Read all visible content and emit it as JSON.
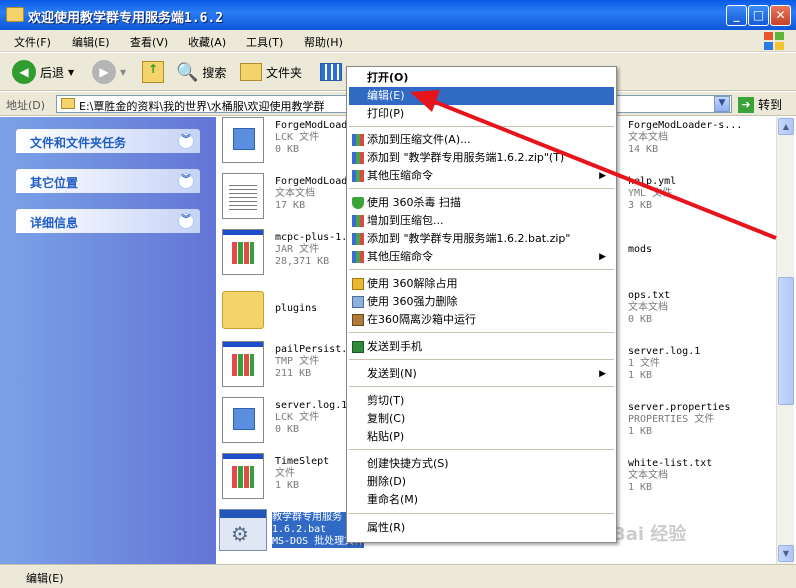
{
  "window": {
    "title": "欢迎使用教学群专用服务端1.6.2",
    "buttons": [
      "_",
      "□",
      "✕"
    ]
  },
  "menubar": [
    "文件(F)",
    "编辑(E)",
    "查看(V)",
    "收藏(A)",
    "工具(T)",
    "帮助(H)"
  ],
  "toolbar": {
    "back": "后退",
    "search": "搜索",
    "folders": "文件夹"
  },
  "address": {
    "label": "地址(D)",
    "path": "E:\\覃胜金的资料\\我的世界\\水桶服\\欢迎使用教学群",
    "go": "转到"
  },
  "left_panels": [
    "文件和文件夹任务",
    "其它位置",
    "详细信息"
  ],
  "files_left": [
    {
      "name": "ForgeModLoade",
      "type": "LCK 文件",
      "size": "0 KB",
      "icon": "blue-doc-icon"
    },
    {
      "name": "ForgeModLoad",
      "type": "文本文档",
      "size": "17 KB",
      "icon": "text-doc-icon"
    },
    {
      "name": "mcpc-plus-1.6",
      "type": "JAR 文件",
      "size": "28,371 KB",
      "icon": "app-doc-icon"
    },
    {
      "name": "plugins",
      "type": "",
      "size": "",
      "icon": "folder-icon"
    },
    {
      "name": "pailPersist.",
      "type": "TMP 文件",
      "size": "211 KB",
      "icon": "app-doc-icon"
    },
    {
      "name": "server.log.1.",
      "type": "LCK 文件",
      "size": "0 KB",
      "icon": "blue-doc-icon"
    },
    {
      "name": "TimeSlept",
      "type": "文件",
      "size": "1 KB",
      "icon": "app-doc-icon"
    }
  ],
  "selected_file": {
    "name": "教学群专用服务",
    "line2": "1.6.2.bat",
    "type": "MS-DOS 批处理文件"
  },
  "files_right": [
    {
      "name": "ForgeModLoader-s...",
      "type": "文本文档",
      "size": "14 KB"
    },
    {
      "name": "help.yml",
      "type": "YML 文件",
      "size": "3 KB"
    },
    {
      "name": "mods",
      "type": "",
      "size": ""
    },
    {
      "name": "ops.txt",
      "type": "文本文档",
      "size": "0 KB"
    },
    {
      "name": "server.log.1",
      "type": "1 文件",
      "size": "1 KB"
    },
    {
      "name": "server.properties",
      "type": "PROPERTIES 文件",
      "size": "1 KB"
    },
    {
      "name": "white-list.txt",
      "type": "文本文档",
      "size": "1 KB"
    }
  ],
  "context_menu": [
    {
      "label": "打开(O)",
      "bold": true
    },
    {
      "label": "编辑(E)",
      "highlight": true
    },
    {
      "label": "打印(P)"
    },
    {
      "sep": true
    },
    {
      "label": "添加到压缩文件(A)...",
      "icon": "winrar-icon"
    },
    {
      "label": "添加到 \"教学群专用服务端1.6.2.zip\"(T)",
      "icon": "winrar-icon"
    },
    {
      "label": "其他压缩命令",
      "icon": "winrar-icon",
      "submenu": true
    },
    {
      "sep": true
    },
    {
      "label": "使用 360杀毒 扫描",
      "icon": "shield-icon"
    },
    {
      "label": "增加到压缩包...",
      "icon": "winrar-icon"
    },
    {
      "label": "添加到 \"教学群专用服务端1.6.2.bat.zip\"",
      "icon": "winrar-icon"
    },
    {
      "label": "其他压缩命令",
      "icon": "winrar-icon",
      "submenu": true
    },
    {
      "sep": true
    },
    {
      "label": "使用 360解除占用",
      "icon": "unlock-icon"
    },
    {
      "label": "使用 360强力删除",
      "icon": "trash-icon"
    },
    {
      "label": "在360隔离沙箱中运行",
      "icon": "sandbox-icon"
    },
    {
      "sep": true
    },
    {
      "label": "发送到手机",
      "icon": "phone-icon"
    },
    {
      "sep": true
    },
    {
      "label": "发送到(N)",
      "submenu": true
    },
    {
      "sep": true
    },
    {
      "label": "剪切(T)"
    },
    {
      "label": "复制(C)"
    },
    {
      "label": "粘贴(P)"
    },
    {
      "sep": true
    },
    {
      "label": "创建快捷方式(S)"
    },
    {
      "label": "删除(D)"
    },
    {
      "label": "重命名(M)"
    },
    {
      "sep": true
    },
    {
      "label": "属性(R)"
    }
  ],
  "status": "编辑(E)",
  "watermark": "Bai 经验",
  "colors": {
    "accent": "#316ac5",
    "annotation": "#e8141c",
    "title_bar": "#0a5ae8"
  }
}
